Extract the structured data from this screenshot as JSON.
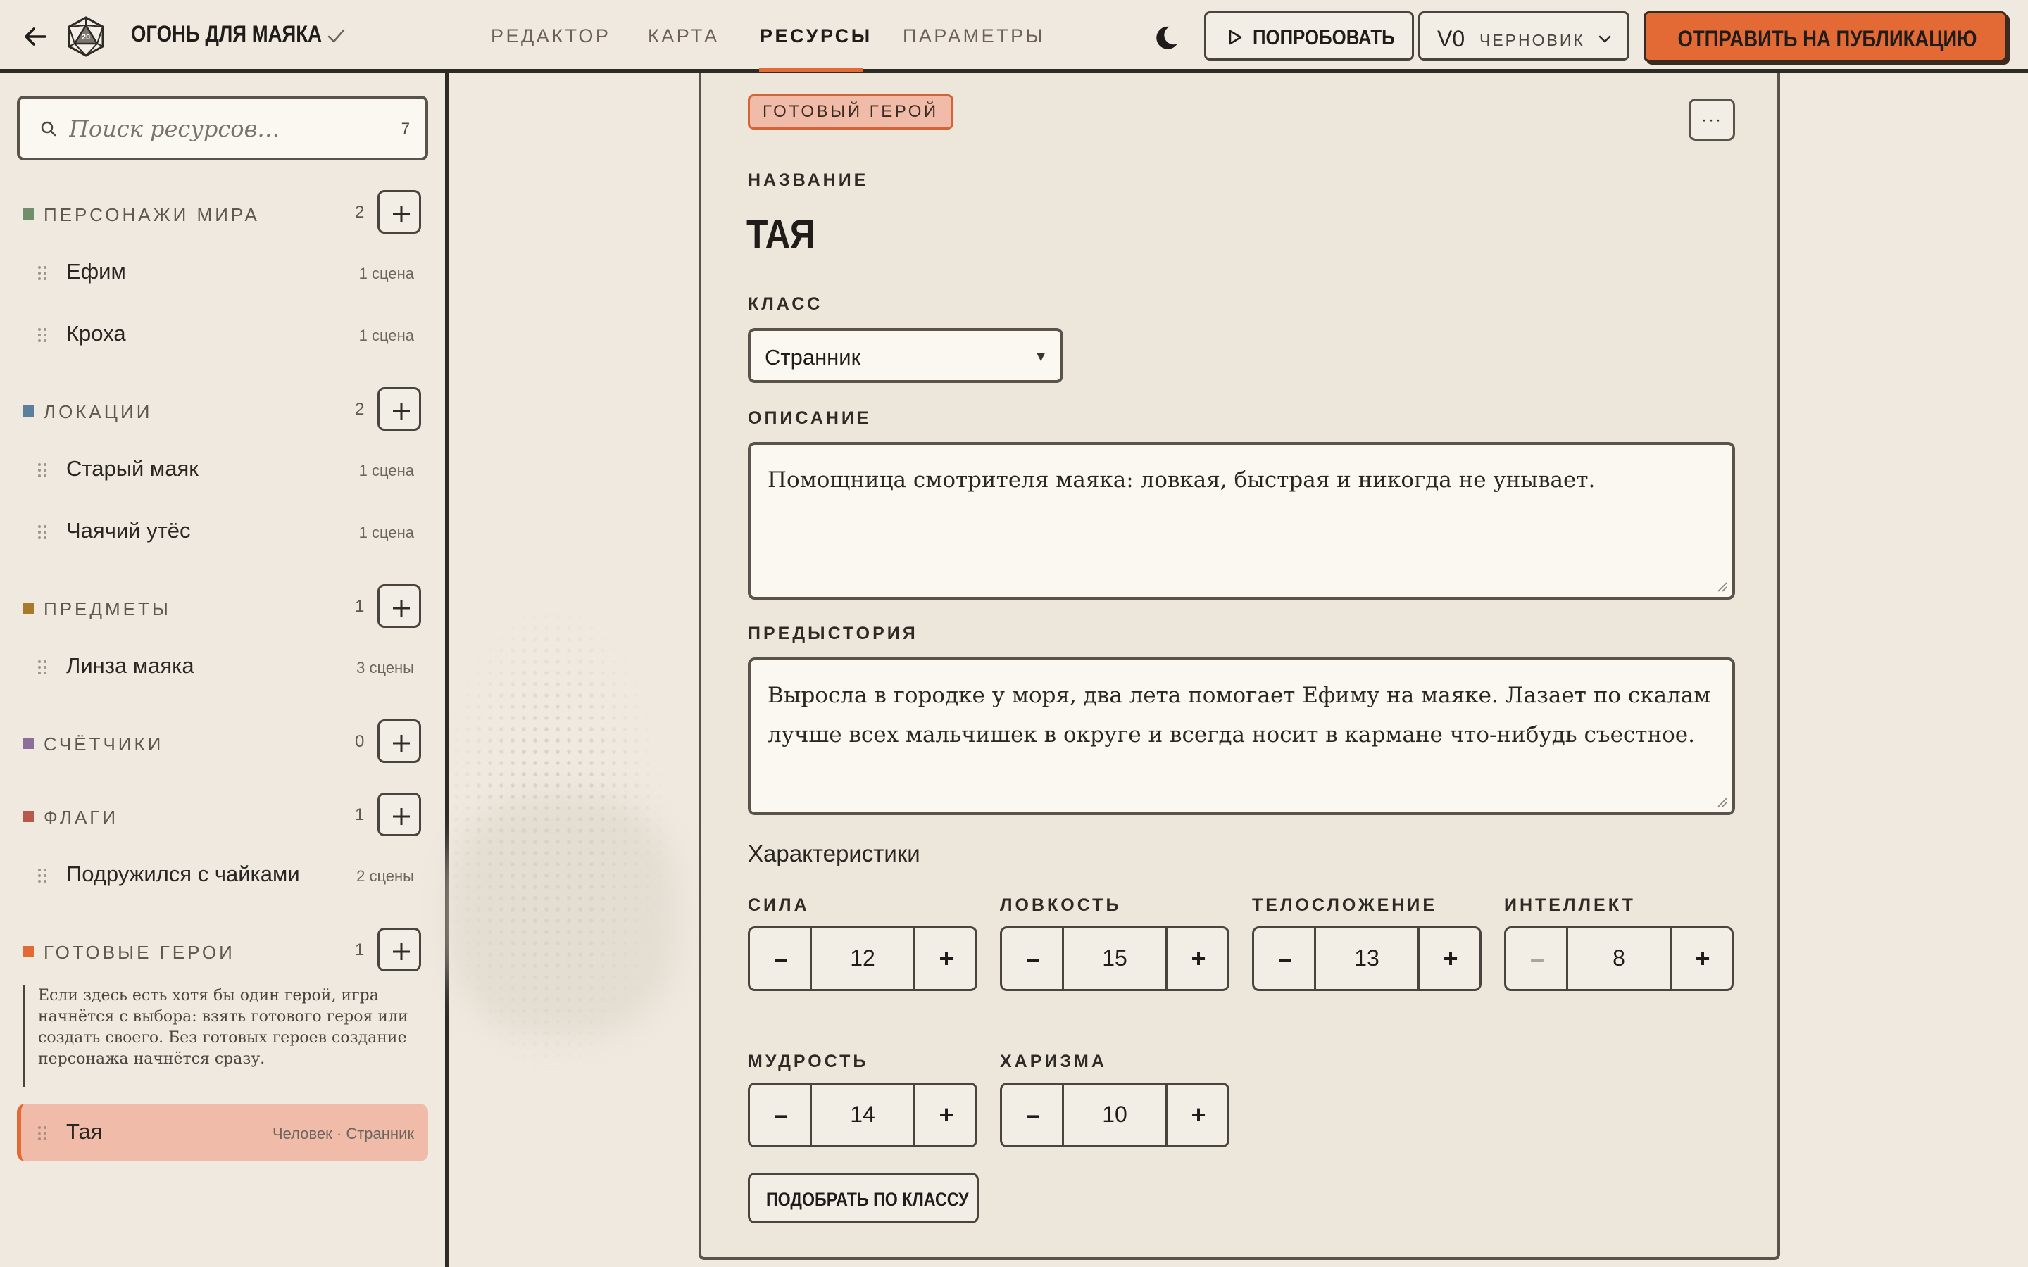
{
  "header": {
    "title": "ОГОНЬ ДЛЯ МАЯКА",
    "tabs": [
      {
        "label": "РЕДАКТОР"
      },
      {
        "label": "КАРТА"
      },
      {
        "label": "РЕСУРСЫ"
      },
      {
        "label": "ПАРАМЕТРЫ"
      }
    ],
    "active_tab": "РЕСУРСЫ",
    "try_label": "ПОПРОБОВАТЬ",
    "version": "V0",
    "version_status": "ЧЕРНОВИК",
    "publish_label": "ОТПРАВИТЬ НА ПУБЛИКАЦИЮ"
  },
  "sidebar": {
    "search_placeholder": "Поиск ресурсов…",
    "search_count": "7",
    "groups": [
      {
        "title": "ПЕРСОНАЖИ МИРА",
        "count": "2",
        "color": "#6e8f6a",
        "items": [
          {
            "name": "Ефим",
            "meta": "1 сцена"
          },
          {
            "name": "Кроха",
            "meta": "1 сцена"
          }
        ]
      },
      {
        "title": "ЛОКАЦИИ",
        "count": "2",
        "color": "#5d7f9e",
        "items": [
          {
            "name": "Старый маяк",
            "meta": "1 сцена"
          },
          {
            "name": "Чаячий утёс",
            "meta": "1 сцена"
          }
        ]
      },
      {
        "title": "ПРЕДМЕТЫ",
        "count": "1",
        "color": "#a77a2c",
        "items": [
          {
            "name": "Линза маяка",
            "meta": "3 сцены"
          }
        ]
      },
      {
        "title": "СЧЁТЧИКИ",
        "count": "0",
        "color": "#8d6d99",
        "items": []
      },
      {
        "title": "ФЛАГИ",
        "count": "1",
        "color": "#b8594c",
        "items": [
          {
            "name": "Подружился с чайками",
            "meta": "2 сцены"
          }
        ]
      },
      {
        "title": "ГОТОВЫЕ ГЕРОИ",
        "count": "1",
        "color": "#e46a35",
        "items": [
          {
            "name": "Тая",
            "meta": "Человек · Странник"
          }
        ]
      }
    ],
    "heroes_note": "Если здесь есть хотя бы один герой, игра начнётся с выбора: взять готового героя или создать своего. Без готовых героев создание персонажа начнётся сразу."
  },
  "editor": {
    "badge": "ГОТОВЫЙ ГЕРОЙ",
    "more_label": "···",
    "name_label": "НАЗВАНИЕ",
    "name_value": "ТАЯ",
    "class_label": "КЛАСС",
    "class_value": "Странник",
    "description_label": "ОПИСАНИЕ",
    "description_value": "Помощница смотрителя маяка: ловкая, быстрая и никогда не унывает.",
    "backstory_label": "ПРЕДЫСТОРИЯ",
    "backstory_value": "Выросла в городке у моря, два лета помогает Ефиму на маяке. Лазает по скалам лучше всех мальчишек в округе и всегда носит в кармане что-нибудь съестное.",
    "stats_title": "Характеристики",
    "stats": [
      {
        "label": "СИЛА",
        "value": "12"
      },
      {
        "label": "ЛОВКОСТЬ",
        "value": "15"
      },
      {
        "label": "ТЕЛОСЛОЖЕНИЕ",
        "value": "13"
      },
      {
        "label": "ИНТЕЛЛЕКТ",
        "value": "8"
      },
      {
        "label": "МУДРОСТЬ",
        "value": "14"
      },
      {
        "label": "ХАРИЗМА",
        "value": "10"
      }
    ],
    "minus_label": "–",
    "plus_label": "+",
    "suggest_label": "ПОДОБРАТЬ ПО КЛАССУ"
  }
}
